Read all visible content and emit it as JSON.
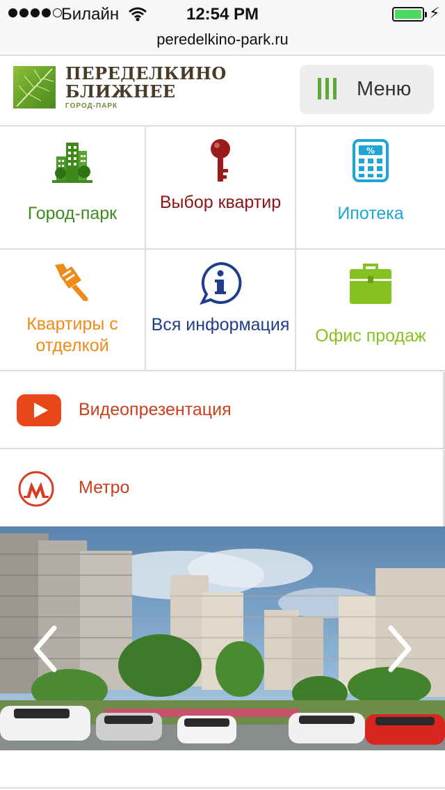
{
  "status_bar": {
    "carrier": "Билайн",
    "time": "12:54 PM",
    "signal_bars_filled": 4,
    "signal_bars_total": 5,
    "battery_level": 1.0
  },
  "browser": {
    "url": "peredelkino-park.ru"
  },
  "header": {
    "logo_line1": "ПЕРЕДЕЛКИНО",
    "logo_line2": "БЛИЖНЕЕ",
    "logo_sub": "ГОРОД-ПАРК",
    "menu_label": "Меню"
  },
  "tiles": [
    {
      "label": "Город-парк",
      "icon": "city-buildings-icon",
      "color": "#3f8a1f"
    },
    {
      "label": "Выбор квартир",
      "icon": "key-icon",
      "color": "#8b1414"
    },
    {
      "label": "Ипотека",
      "icon": "calculator-icon",
      "color": "#1aa6d6"
    },
    {
      "label": "Квартиры с отделкой",
      "icon": "paint-brush-icon",
      "color": "#f08a16"
    },
    {
      "label": "Вся информация",
      "icon": "info-bubble-icon",
      "color": "#1f3d8a"
    },
    {
      "label": "Офис продаж",
      "icon": "briefcase-icon",
      "color": "#86c21f"
    }
  ],
  "rows": [
    {
      "label": "Видеопрезентация",
      "icon": "youtube-play-icon",
      "color": "#c8401e"
    },
    {
      "label": "Метро",
      "icon": "metro-m-icon",
      "color": "#c8401e"
    }
  ],
  "carousel": {
    "image": "residential-complex-render",
    "prev_icon": "chevron-left-icon",
    "next_icon": "chevron-right-icon"
  }
}
